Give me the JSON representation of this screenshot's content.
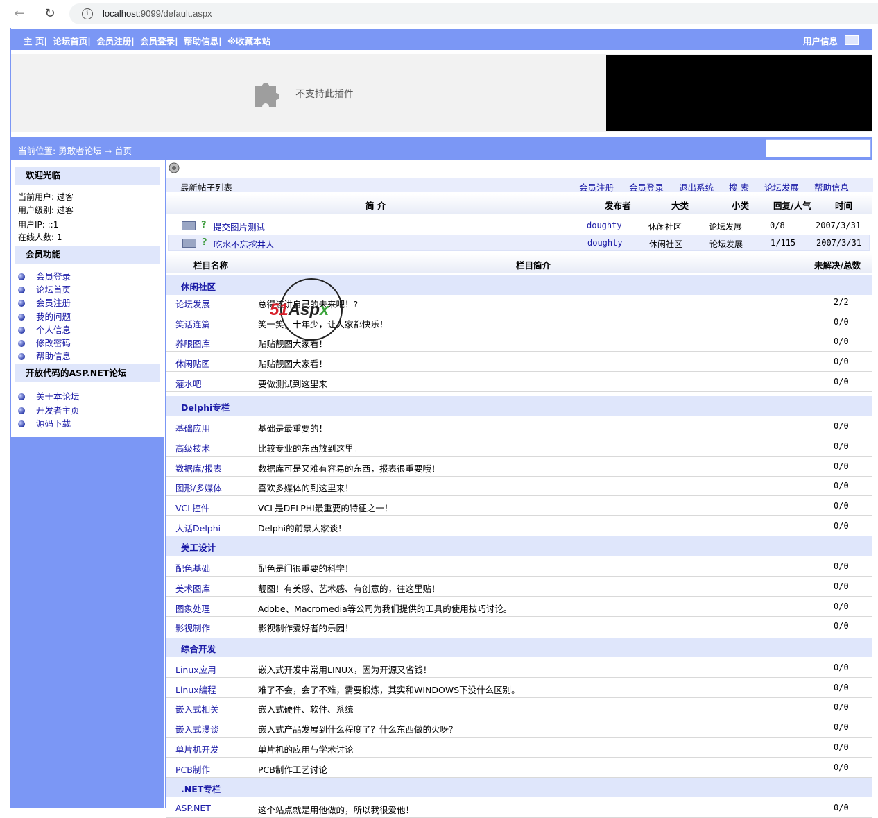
{
  "browser": {
    "url_host": "localhost",
    "url_path": ":9099/default.aspx",
    "back": "←",
    "reload": "↻"
  },
  "topnav": {
    "links": [
      "主 页|",
      "论坛首页|",
      "会员注册|",
      "会员登录|",
      "帮助信息|",
      "※收藏本站"
    ],
    "user_info": "用户信息"
  },
  "banner": {
    "plugin_text": "不支持此插件"
  },
  "breadcrumb": "当前位置: 勇敢者论坛 → 首页",
  "sidebar": {
    "welcome_title": "欢迎光临",
    "current_user": "当前用户: 过客",
    "user_level": "用户级别: 过客",
    "user_ip": "用户IP: ::1",
    "online": "在线人数: 1",
    "member_title": "会员功能",
    "member_links": [
      "会员登录",
      "论坛首页",
      "会员注册",
      "我的问题",
      "个人信息",
      "修改密码",
      "帮助信息"
    ],
    "open_title": "开放代码的ASP.NET论坛",
    "open_links": [
      "关于本论坛",
      "开发者主页",
      "源码下载"
    ]
  },
  "posts": {
    "list_label": "最新帖子列表",
    "top_links": [
      "会员注册",
      "会员登录",
      "退出系统",
      "搜 索",
      "论坛发展",
      "帮助信息"
    ],
    "headers": {
      "intro": "简 介",
      "author": "发布者",
      "major": "大类",
      "minor": "小类",
      "reply": "回复/人气",
      "time": "时间"
    },
    "rows": [
      {
        "title": "提交图片测试",
        "author": "doughty",
        "major": "休闲社区",
        "minor": "论坛发展",
        "reply": "0/8",
        "time": "2007/3/31"
      },
      {
        "title": "吃水不忘挖井人",
        "author": "doughty",
        "major": "休闲社区",
        "minor": "论坛发展",
        "reply": "1/115",
        "time": "2007/3/31"
      }
    ]
  },
  "forums": {
    "headers": {
      "name": "栏目名称",
      "desc": "栏目简介",
      "count": "未解决/总数"
    },
    "categories": [
      {
        "name": "休闲社区",
        "items": [
          {
            "name": "论坛发展",
            "desc": "总得该讲自己的未来吧！?",
            "count": "2/2"
          },
          {
            "name": "笑话连篇",
            "desc": "笑一笑，十年少，让大家都快乐！",
            "count": "0/0"
          },
          {
            "name": "养眼图库",
            "desc": "贴贴靓图大家看！",
            "count": "0/0"
          },
          {
            "name": "休闲贴图",
            "desc": "贴贴靓图大家看！",
            "count": "0/0"
          },
          {
            "name": "灌水吧",
            "desc": "要做测试到这里来",
            "count": "0/0"
          }
        ]
      },
      {
        "name": "Delphi专栏",
        "items": [
          {
            "name": "基础应用",
            "desc": "基础是最重要的！",
            "count": "0/0"
          },
          {
            "name": "高级技术",
            "desc": "比较专业的东西放到这里。",
            "count": "0/0"
          },
          {
            "name": "数据库/报表",
            "desc": "数据库可是又难有容易的东西，报表很重要哦！",
            "count": "0/0"
          },
          {
            "name": "图形/多媒体",
            "desc": "喜欢多媒体的到这里来！",
            "count": "0/0"
          },
          {
            "name": "VCL控件",
            "desc": "VCL是DELPHI最重要的特征之一！",
            "count": "0/0"
          },
          {
            "name": "大话Delphi",
            "desc": "Delphi的前景大家谈！",
            "count": "0/0"
          }
        ]
      },
      {
        "name": "美工设计",
        "items": [
          {
            "name": "配色基础",
            "desc": "配色是门很重要的科学！",
            "count": "0/0"
          },
          {
            "name": "美术图库",
            "desc": "靓图！有美感、艺术感、有创意的，往这里贴！",
            "count": "0/0"
          },
          {
            "name": "图象处理",
            "desc": "Adobe、Macromedia等公司为我们提供的工具的使用技巧讨论。",
            "count": "0/0"
          },
          {
            "name": "影视制作",
            "desc": "影视制作爱好者的乐园！",
            "count": "0/0"
          }
        ]
      },
      {
        "name": "综合开发",
        "items": [
          {
            "name": "Linux应用",
            "desc": "嵌入式开发中常用LINUX，因为开源又省钱！",
            "count": "0/0"
          },
          {
            "name": "Linux编程",
            "desc": "难了不会，会了不难，需要锻炼，其实和WINDOWS下没什么区别。",
            "count": "0/0"
          },
          {
            "name": "嵌入式相关",
            "desc": "嵌入式硬件、软件、系统",
            "count": "0/0"
          },
          {
            "name": "嵌入式漫谈",
            "desc": "嵌入式产品发展到什么程度了？什么东西做的火呀？",
            "count": "0/0"
          },
          {
            "name": "单片机开发",
            "desc": "单片机的应用与学术讨论",
            "count": "0/0"
          },
          {
            "name": "PCB制作",
            "desc": "PCB制作工艺讨论",
            "count": "0/0"
          }
        ]
      },
      {
        "name": ".NET专栏",
        "items": [
          {
            "name": "ASP.NET",
            "desc": "这个站点就是用他做的，所以我很爱他！",
            "count": "0/0"
          }
        ]
      }
    ]
  },
  "watermark": {
    "part1": "51",
    "part2": "Asp",
    "part3": "x"
  }
}
